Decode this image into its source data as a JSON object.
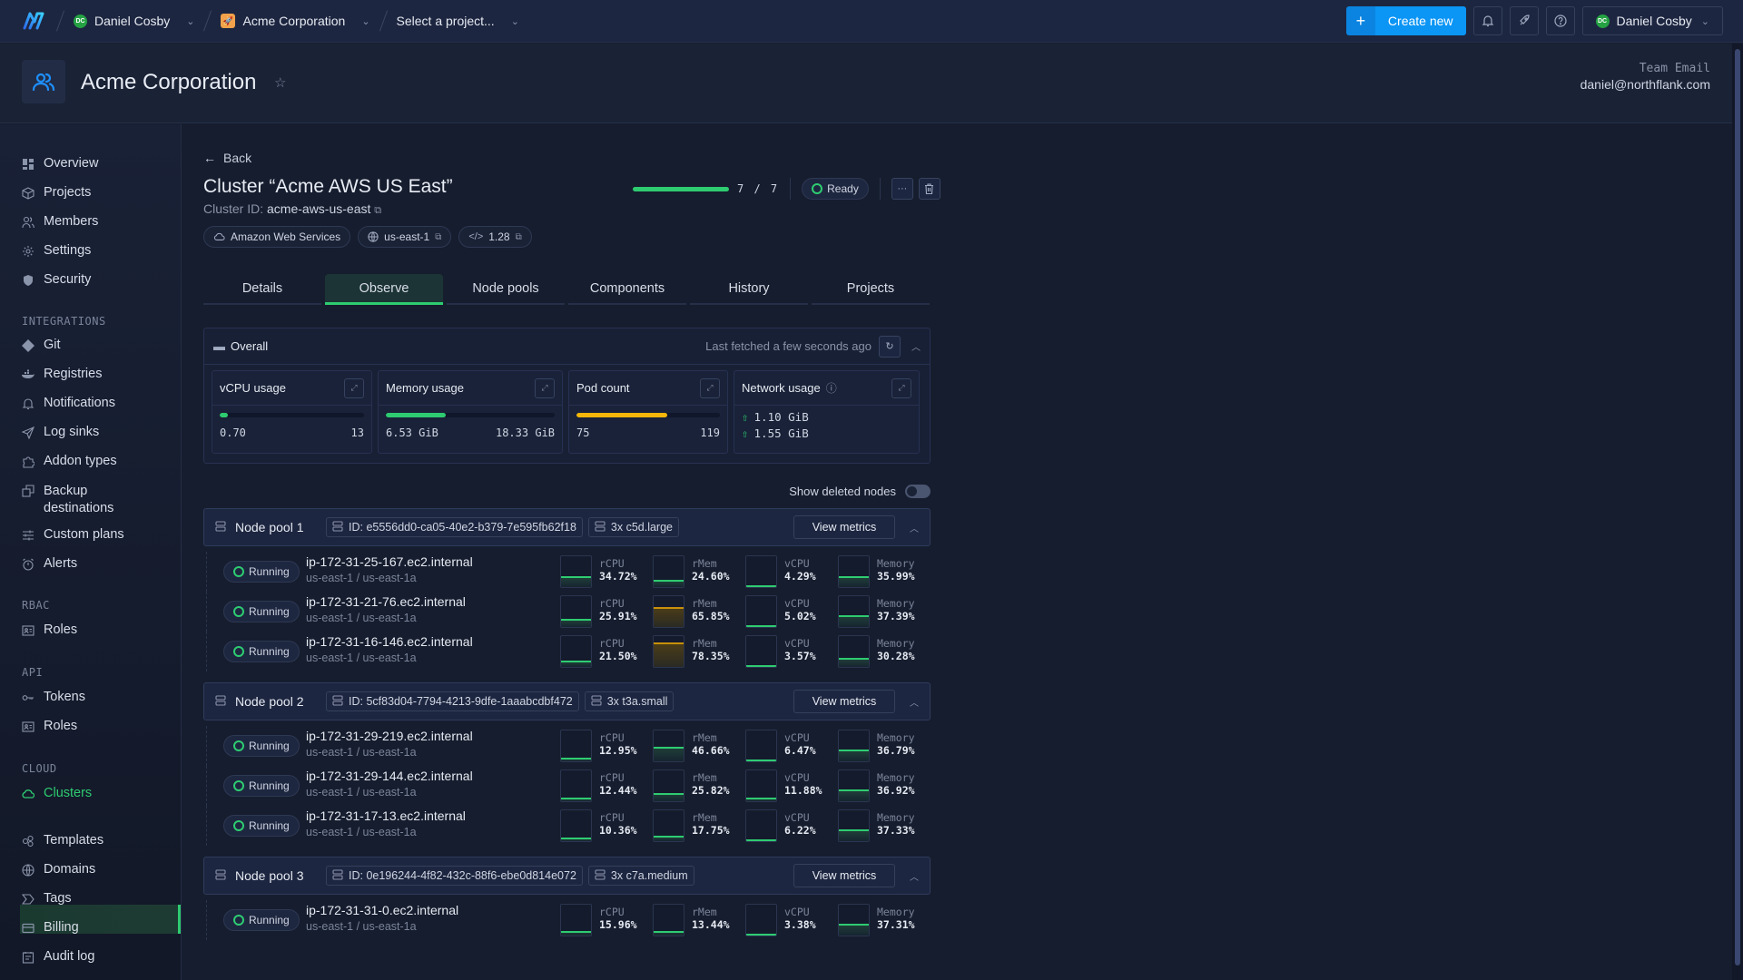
{
  "topbar": {
    "user": "Daniel Cosby",
    "user_initials": "DC",
    "org": "Acme Corporation",
    "project": "Select a project...",
    "create_label": "Create new",
    "account": "Daniel Cosby"
  },
  "header": {
    "org_title": "Acme Corporation",
    "team_email_label": "Team Email",
    "team_email": "daniel@northflank.com"
  },
  "sidebar": {
    "items": [
      {
        "label": "Overview",
        "icon": "grid-icon"
      },
      {
        "label": "Projects",
        "icon": "box-icon"
      },
      {
        "label": "Members",
        "icon": "users-icon"
      },
      {
        "label": "Settings",
        "icon": "gear-icon"
      },
      {
        "label": "Security",
        "icon": "shield-icon"
      }
    ],
    "integrations_label": "INTEGRATIONS",
    "integrations": [
      {
        "label": "Git",
        "icon": "git-icon"
      },
      {
        "label": "Registries",
        "icon": "docker-icon"
      },
      {
        "label": "Notifications",
        "icon": "bell-icon"
      },
      {
        "label": "Log sinks",
        "icon": "send-icon"
      },
      {
        "label": "Addon types",
        "icon": "puzzle-icon"
      },
      {
        "label": "Backup destinations",
        "icon": "copy-icon"
      },
      {
        "label": "Custom plans",
        "icon": "sliders-icon"
      },
      {
        "label": "Alerts",
        "icon": "alarm-icon"
      }
    ],
    "rbac_label": "RBAC",
    "rbac": [
      {
        "label": "Roles",
        "icon": "id-card-icon"
      }
    ],
    "api_label": "API",
    "api": [
      {
        "label": "Tokens",
        "icon": "key-icon"
      },
      {
        "label": "Roles",
        "icon": "id-card-icon"
      }
    ],
    "cloud_label": "CLOUD",
    "cloud": [
      {
        "label": "Clusters",
        "icon": "cloud-icon",
        "active": true
      }
    ],
    "bottom": [
      {
        "label": "Templates",
        "icon": "templates-icon"
      },
      {
        "label": "Domains",
        "icon": "globe-icon"
      },
      {
        "label": "Tags",
        "icon": "tag-icon"
      },
      {
        "label": "Billing",
        "icon": "card-icon"
      },
      {
        "label": "Audit log",
        "icon": "calendar-icon"
      }
    ]
  },
  "cluster": {
    "back_label": "Back",
    "title": "Cluster “Acme AWS US East”",
    "id_label": "Cluster ID:",
    "id": "acme-aws-us-east",
    "provider": "Amazon Web Services",
    "region": "us-east-1",
    "version": "1.28",
    "nodes_ready": 7,
    "nodes_total": 7,
    "nodes_text": "7 / 7",
    "status": "Ready"
  },
  "tabs": [
    "Details",
    "Observe",
    "Node pools",
    "Components",
    "History",
    "Projects"
  ],
  "active_tab": "Observe",
  "overall": {
    "title": "Overall",
    "fetched": "Last fetched a few seconds ago",
    "vcpu": {
      "label": "vCPU usage",
      "used": "0.70",
      "total": "13",
      "fraction": 0.054
    },
    "memory": {
      "label": "Memory usage",
      "used": "6.53 GiB",
      "total": "18.33 GiB",
      "fraction": 0.356
    },
    "pods": {
      "label": "Pod count",
      "used": "75",
      "total": "119",
      "fraction": 0.63
    },
    "network": {
      "label": "Network usage",
      "tx": "1.10 GiB",
      "rx": "1.55 GiB"
    }
  },
  "show_deleted_label": "Show deleted nodes",
  "view_metrics_label": "View metrics",
  "node_pools": [
    {
      "name": "Node pool 1",
      "id": "ID: e5556dd0-ca05-40e2-b379-7e595fb62f18",
      "type": "3x c5d.large",
      "nodes": [
        {
          "status": "Running",
          "name": "ip-172-31-25-167.ec2.internal",
          "zone": "us-east-1 / us-east-1a",
          "rcpu": "34.72%",
          "rmem": "24.60%",
          "vcpu": "4.29%",
          "mem": "35.99%"
        },
        {
          "status": "Running",
          "name": "ip-172-31-21-76.ec2.internal",
          "zone": "us-east-1 / us-east-1a",
          "rcpu": "25.91%",
          "rmem": "65.85%",
          "vcpu": "5.02%",
          "mem": "37.39%"
        },
        {
          "status": "Running",
          "name": "ip-172-31-16-146.ec2.internal",
          "zone": "us-east-1 / us-east-1a",
          "rcpu": "21.50%",
          "rmem": "78.35%",
          "vcpu": "3.57%",
          "mem": "30.28%"
        }
      ]
    },
    {
      "name": "Node pool 2",
      "id": "ID: 5cf83d04-7794-4213-9dfe-1aaabcdbf472",
      "type": "3x t3a.small",
      "nodes": [
        {
          "status": "Running",
          "name": "ip-172-31-29-219.ec2.internal",
          "zone": "us-east-1 / us-east-1a",
          "rcpu": "12.95%",
          "rmem": "46.66%",
          "vcpu": "6.47%",
          "mem": "36.79%"
        },
        {
          "status": "Running",
          "name": "ip-172-31-29-144.ec2.internal",
          "zone": "us-east-1 / us-east-1a",
          "rcpu": "12.44%",
          "rmem": "25.82%",
          "vcpu": "11.88%",
          "mem": "36.92%"
        },
        {
          "status": "Running",
          "name": "ip-172-31-17-13.ec2.internal",
          "zone": "us-east-1 / us-east-1a",
          "rcpu": "10.36%",
          "rmem": "17.75%",
          "vcpu": "6.22%",
          "mem": "37.33%"
        }
      ]
    },
    {
      "name": "Node pool 3",
      "id": "ID: 0e196244-4f82-432c-88f6-ebe0d814e072",
      "type": "3x c7a.medium",
      "nodes": [
        {
          "status": "Running",
          "name": "ip-172-31-31-0.ec2.internal",
          "zone": "us-east-1 / us-east-1a",
          "rcpu": "15.96%",
          "rmem": "13.44%",
          "vcpu": "3.38%",
          "mem": "37.31%"
        }
      ]
    }
  ],
  "metric_labels": {
    "rcpu": "rCPU",
    "rmem": "rMem",
    "vcpu": "vCPU",
    "mem": "Memory"
  },
  "colors": {
    "accent": "#2ecc71",
    "warning": "#f5b70a",
    "primary": "#0b95f5"
  }
}
